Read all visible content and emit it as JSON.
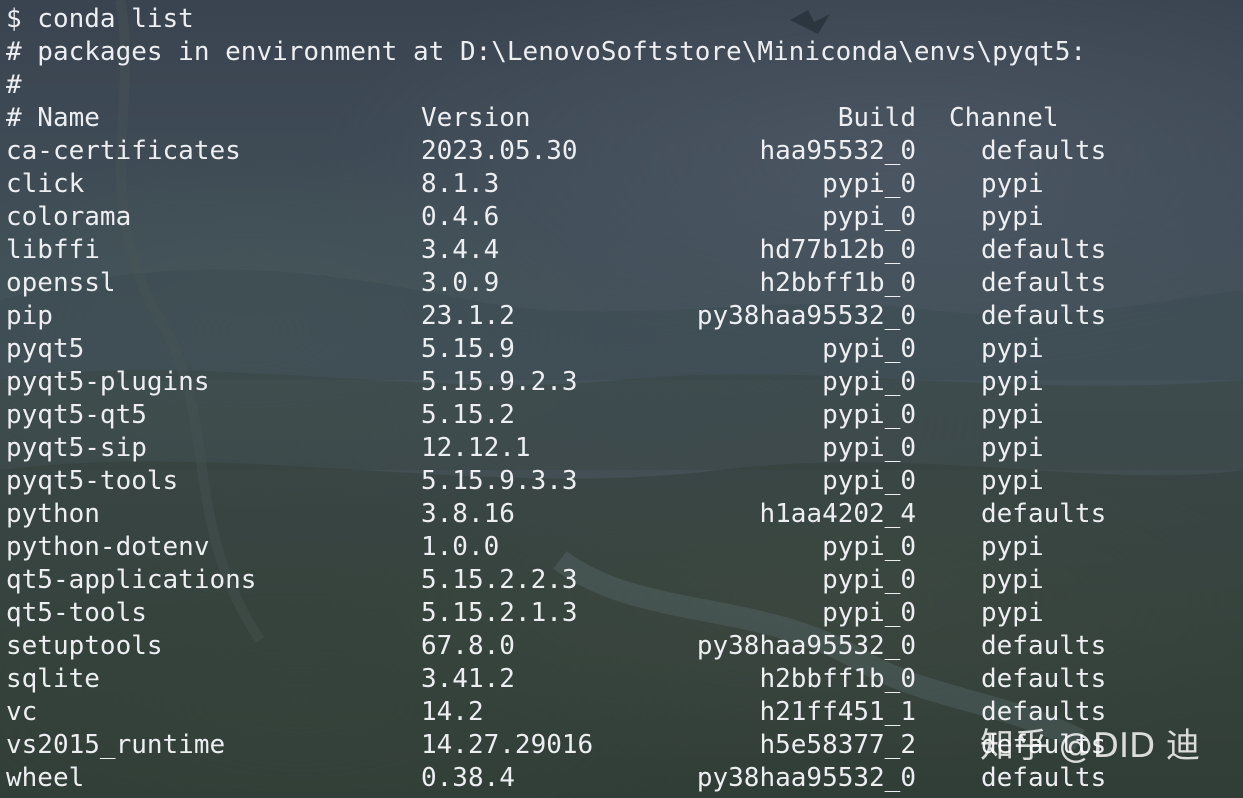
{
  "terminal": {
    "prompt_line": "$ conda list",
    "env_line": "# packages in environment at D:\\LenovoSoftstore\\Miniconda\\envs\\pyqt5:",
    "blank_comment": "#",
    "header": {
      "name": "# Name",
      "version": "Version",
      "build": "Build",
      "channel": "Channel"
    },
    "packages": [
      {
        "name": "ca-certificates",
        "version": "2023.05.30",
        "build": "haa95532_0",
        "channel": "defaults"
      },
      {
        "name": "click",
        "version": "8.1.3",
        "build": "pypi_0",
        "channel": "pypi"
      },
      {
        "name": "colorama",
        "version": "0.4.6",
        "build": "pypi_0",
        "channel": "pypi"
      },
      {
        "name": "libffi",
        "version": "3.4.4",
        "build": "hd77b12b_0",
        "channel": "defaults"
      },
      {
        "name": "openssl",
        "version": "3.0.9",
        "build": "h2bbff1b_0",
        "channel": "defaults"
      },
      {
        "name": "pip",
        "version": "23.1.2",
        "build": "py38haa95532_0",
        "channel": "defaults"
      },
      {
        "name": "pyqt5",
        "version": "5.15.9",
        "build": "pypi_0",
        "channel": "pypi"
      },
      {
        "name": "pyqt5-plugins",
        "version": "5.15.9.2.3",
        "build": "pypi_0",
        "channel": "pypi"
      },
      {
        "name": "pyqt5-qt5",
        "version": "5.15.2",
        "build": "pypi_0",
        "channel": "pypi"
      },
      {
        "name": "pyqt5-sip",
        "version": "12.12.1",
        "build": "pypi_0",
        "channel": "pypi"
      },
      {
        "name": "pyqt5-tools",
        "version": "5.15.9.3.3",
        "build": "pypi_0",
        "channel": "pypi"
      },
      {
        "name": "python",
        "version": "3.8.16",
        "build": "h1aa4202_4",
        "channel": "defaults"
      },
      {
        "name": "python-dotenv",
        "version": "1.0.0",
        "build": "pypi_0",
        "channel": "pypi"
      },
      {
        "name": "qt5-applications",
        "version": "5.15.2.2.3",
        "build": "pypi_0",
        "channel": "pypi"
      },
      {
        "name": "qt5-tools",
        "version": "5.15.2.1.3",
        "build": "pypi_0",
        "channel": "pypi"
      },
      {
        "name": "setuptools",
        "version": "67.8.0",
        "build": "py38haa95532_0",
        "channel": "defaults"
      },
      {
        "name": "sqlite",
        "version": "3.41.2",
        "build": "h2bbff1b_0",
        "channel": "defaults"
      },
      {
        "name": "vc",
        "version": "14.2",
        "build": "h21ff451_1",
        "channel": "defaults"
      },
      {
        "name": "vs2015_runtime",
        "version": "14.27.29016",
        "build": "h5e58377_2",
        "channel": "defaults"
      },
      {
        "name": "wheel",
        "version": "0.38.4",
        "build": "py38haa95532_0",
        "channel": "defaults"
      }
    ]
  },
  "watermark": "知乎 @DID 迪",
  "colors": {
    "text": "#eceef2",
    "background_dark": "#2f3a33",
    "background_light": "#44525a"
  }
}
